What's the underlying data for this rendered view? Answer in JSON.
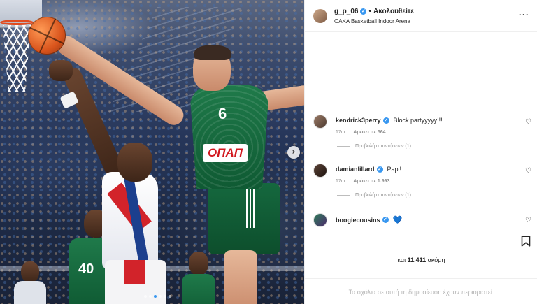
{
  "post": {
    "owner": "g_p_06",
    "separator": "•",
    "follow_label": "Ακολουθείτε",
    "location": "OAKA Basketball Indoor Arena",
    "more_icon": "ellipsis-icon",
    "more_label": "···"
  },
  "photo": {
    "player_number_front": "6",
    "player_number_back": "40",
    "sponsor_text": "OΠAΠ",
    "nav_next_label": "›",
    "carousel_dots": 6,
    "carousel_active_index": 2
  },
  "comments": [
    {
      "user": "kendrick3perry",
      "verified": true,
      "text": "Block partyyyyy!!!",
      "emoji": "",
      "time": "17ω",
      "likes": "Αρέσει σε 564",
      "replies": "Προβολή απαντήσεων (1)"
    },
    {
      "user": "damianlillard",
      "verified": true,
      "text": "Papi!",
      "emoji": "",
      "time": "17ω",
      "likes": "Αρέσει σε 1.993",
      "replies": "Προβολή απαντήσεων (1)"
    },
    {
      "user": "boogiecousins",
      "verified": true,
      "text": "",
      "emoji": "💙",
      "time": "",
      "likes": "",
      "replies": ""
    }
  ],
  "likes_summary": {
    "prefix": "και",
    "count": "11,411",
    "suffix": "ακόμη"
  },
  "footer": {
    "restricted_text": "Τα σχόλια σε αυτή τη δημοσίευση έχουν περιοριστεί."
  },
  "icons": {
    "heart": "heart-outline-icon",
    "bookmark": "bookmark-icon",
    "verified": "verified-badge-icon"
  },
  "colors": {
    "accent": "#3897f0",
    "panel_border": "#efefef",
    "muted_text": "#8e8e8e",
    "green_jersey": "#1f7a4a",
    "red_stripe": "#d2232a"
  }
}
